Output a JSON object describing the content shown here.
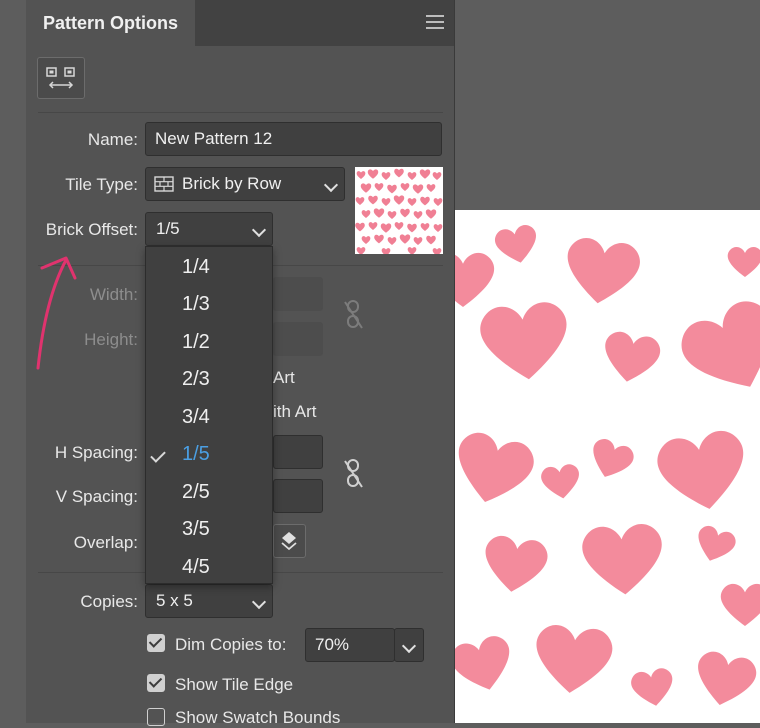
{
  "panel": {
    "title": "Pattern Options",
    "menu_icon": "hamburger-menu-icon",
    "tool_icon": "pattern-tile-tool-icon"
  },
  "fields": {
    "name_label": "Name:",
    "name_value": "New Pattern 12",
    "tile_type_label": "Tile Type:",
    "tile_type_value": "Brick by Row",
    "brick_offset_label": "Brick Offset:",
    "brick_offset_value": "1/5",
    "width_label": "Width:",
    "height_label": "Height:",
    "size_tile_partial": "Art",
    "move_tile_partial": "ith Art",
    "h_spacing_label": "H Spacing:",
    "v_spacing_label": "V Spacing:",
    "overlap_label": "Overlap:",
    "copies_label": "Copies:",
    "copies_value": "5 x 5",
    "dim_copies_label": "Dim Copies to:",
    "dim_copies_value": "70%",
    "show_tile_edge_label": "Show Tile Edge",
    "show_swatch_bounds_label": "Show Swatch Bounds"
  },
  "checkboxes": {
    "dim_copies": true,
    "show_tile_edge": true,
    "show_swatch_bounds": false
  },
  "brick_offset_menu": {
    "options": [
      "1/4",
      "1/3",
      "1/2",
      "2/3",
      "3/4",
      "1/5",
      "2/5",
      "3/5",
      "4/5"
    ],
    "selected": "1/5"
  },
  "colors": {
    "heart": "#f38b9c",
    "accent_selected": "#4b9fe3",
    "annotation_arrow": "#e0336e",
    "panel_bg": "#535353"
  }
}
